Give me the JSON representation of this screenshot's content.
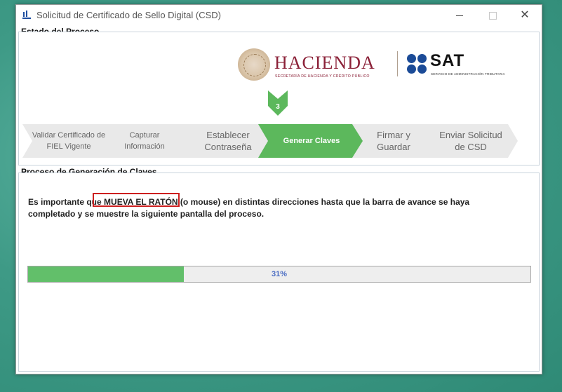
{
  "window": {
    "title": "Solicitud de Certificado de Sello Digital (CSD)",
    "controls": {
      "minimize": "",
      "maximize": "",
      "close": "✕"
    }
  },
  "status_section": {
    "title": "Estado del Proceso"
  },
  "logos": {
    "hacienda": {
      "title": "HACIENDA",
      "subtitle": "SECRETARÍA DE HACIENDA Y CRÉDITO PÚBLICO"
    },
    "sat": {
      "title": "SAT",
      "subtitle": "SERVICIO DE ADMINISTRACIÓN TRIBUTARIA"
    }
  },
  "current_step": {
    "number": "3"
  },
  "steps": [
    {
      "label": "Validar Certificado de FIEL Vigente",
      "active": false
    },
    {
      "label": "Capturar Información",
      "active": false
    },
    {
      "label": "Establecer Contraseña",
      "active": false
    },
    {
      "label": "Generar Claves",
      "active": true
    },
    {
      "label": "Firmar y Guardar",
      "active": false
    },
    {
      "label": "Enviar Solicitud de CSD",
      "active": false
    }
  ],
  "generation_section": {
    "title": "Proceso de Generación de Claves",
    "message": {
      "before": "Es importante que ",
      "emphasis": "MUEVA EL RATÓN",
      "after": " (o mouse) en distintas direcciones hasta que la barra de avance se haya completado y se muestre la siguiente pantalla del proceso."
    }
  },
  "progress": {
    "percent": 31,
    "label": "31%"
  },
  "colors": {
    "active_step": "#5cb85c",
    "inactive_step": "#e9e9e9",
    "progress_fill": "#62bf6a",
    "progress_text": "#4d6fc4",
    "highlight_border": "#cc1f1f",
    "hacienda_brand": "#8b2138",
    "sat_brand": "#1b4b97"
  }
}
